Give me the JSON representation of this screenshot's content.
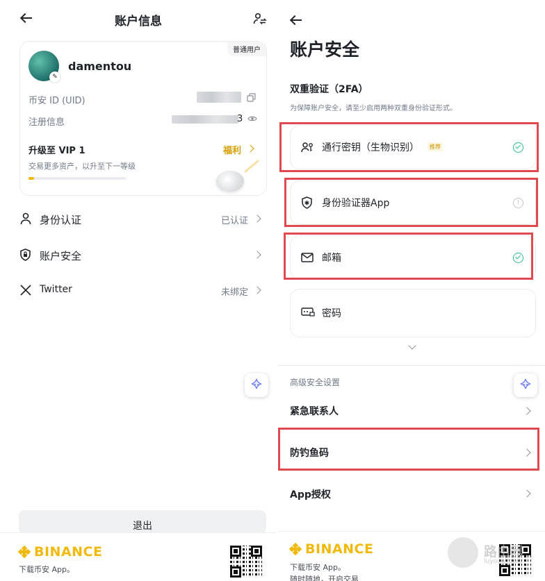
{
  "left": {
    "title": "账户信息",
    "profile": {
      "badge": "普通用户",
      "username": "damentou",
      "uid_label": "币安 ID (UID)",
      "reg_label": "注册信息",
      "reg_value_tail": "3",
      "vip_title": "升级至 VIP 1",
      "vip_desc": "交易更多资产，以升至下一等级",
      "benefits_label": "福利",
      "progress_percent": 6
    },
    "menu": [
      {
        "label": "身份认证",
        "value": "已认证",
        "icon": "person-icon"
      },
      {
        "label": "账户安全",
        "value": "",
        "icon": "shield-lock-icon"
      },
      {
        "label": "Twitter",
        "value": "未绑定",
        "icon": "x-logo-icon"
      }
    ],
    "bottom_button_partial": "退出",
    "footer": {
      "brand": "BINANCE",
      "download_text": "下载币安 App。"
    }
  },
  "right": {
    "title": "账户安全",
    "tfa_heading": "双重验证（2FA）",
    "tfa_desc": "为保障账户安全，请至少启用两种双重身份验证形式。",
    "methods": [
      {
        "label": "通行密钥（生物识别）",
        "tag": "推荐",
        "status": "enabled",
        "icon": "passkey-icon"
      },
      {
        "label": "身份验证器App",
        "tag": "",
        "status": "not-set",
        "icon": "authenticator-icon"
      },
      {
        "label": "邮箱",
        "tag": "",
        "status": "enabled",
        "icon": "mail-icon"
      },
      {
        "label": "密码",
        "tag": "",
        "status": "",
        "icon": "password-icon"
      }
    ],
    "advanced_heading": "高级安全设置",
    "advanced_items": [
      "紧急联系人",
      "防钓鱼码",
      "App授权"
    ],
    "footer": {
      "brand": "BINANCE",
      "download_text": "下载币安 App。",
      "partial_text": "随时随地，开启交易",
      "watermark": "路由器",
      "watermark_url": "luyouqi.com"
    }
  },
  "colors": {
    "accent": "#f0b90b",
    "success": "#2ebd85",
    "highlight_border": "#e04a4f",
    "text": "#1e2329",
    "muted": "#707a8a"
  }
}
